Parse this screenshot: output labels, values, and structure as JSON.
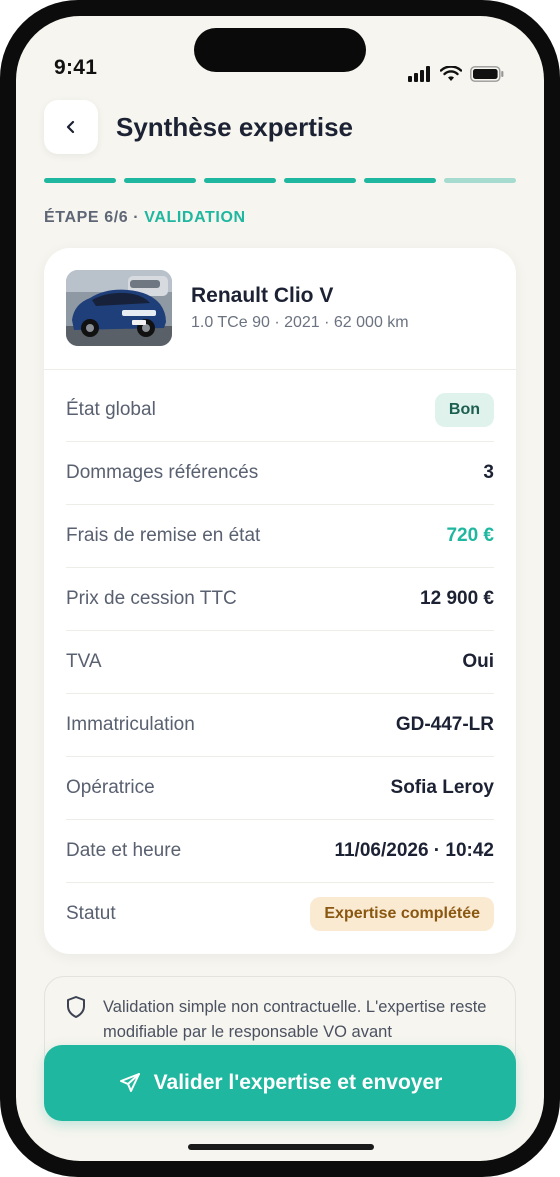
{
  "status_bar": {
    "time": "9:41"
  },
  "header": {
    "title": "Synthèse expertise"
  },
  "progress": {
    "total_steps": 6,
    "current_step": 6
  },
  "step": {
    "prefix": "ÉTAPE 6/6 ·",
    "name": "VALIDATION"
  },
  "vehicle": {
    "name": "Renault Clio V",
    "details": "1.0 TCe 90 · 2021 · 62 000 km"
  },
  "summary": {
    "etat_global": {
      "label": "État global",
      "value": "Bon"
    },
    "dommages": {
      "label": "Dommages référencés",
      "value": "3"
    },
    "frais": {
      "label": "Frais de remise en état",
      "value": "720 €"
    },
    "prix": {
      "label": "Prix de cession TTC",
      "value": "12 900 €"
    },
    "tva": {
      "label": "TVA",
      "value": "Oui"
    },
    "immat": {
      "label": "Immatriculation",
      "value": "GD-447-LR"
    },
    "operatrice": {
      "label": "Opératrice",
      "value": "Sofia Leroy"
    },
    "date": {
      "label": "Date et heure",
      "value": "11/06/2026 · 10:42"
    },
    "statut": {
      "label": "Statut",
      "value": "Expertise complétée"
    }
  },
  "notice": {
    "text": "Validation simple non contractuelle. L'expertise reste modifiable par le responsable VO avant"
  },
  "cta": {
    "label": "Valider l'expertise et envoyer"
  },
  "colors": {
    "accent": "#1fb79f",
    "accent_light": "#a5dccf",
    "badge_good_bg": "#dff3ec",
    "badge_done_bg": "#fbead2",
    "background": "#f6f5ef"
  },
  "icons": {
    "back": "chevron-left-icon",
    "notice": "shield-icon",
    "cta": "send-icon"
  }
}
